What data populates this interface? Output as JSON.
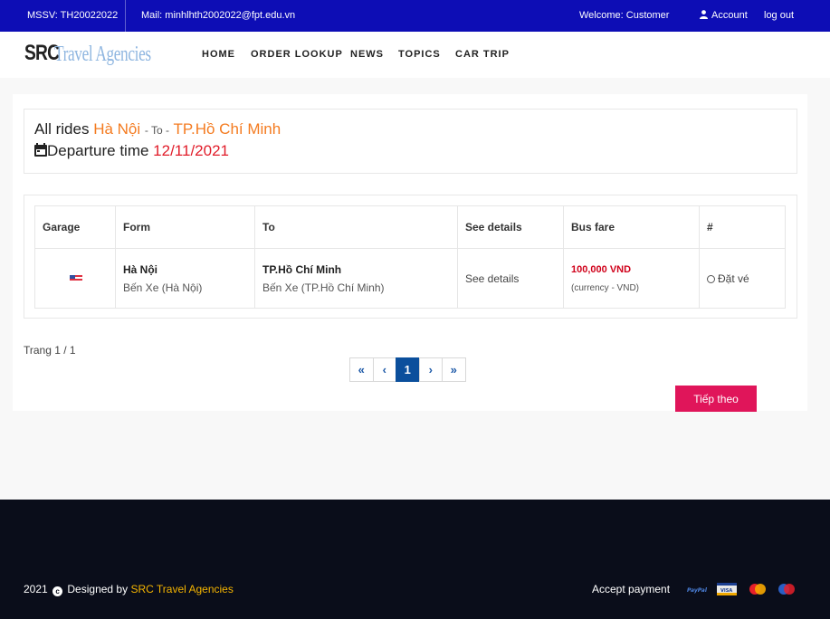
{
  "topbar": {
    "mssv": "MSSV: TH20022022",
    "mail": "Mail: minhlhth2002022@fpt.edu.vn",
    "welcome": "Welcome: Customer",
    "account": "Account",
    "logout": "log out"
  },
  "logo": {
    "src": "SRC",
    "rest": "Travel Agencies"
  },
  "nav": [
    "HOME",
    "ORDER LOOKUP",
    "NEWS",
    "TOPICS",
    "CAR TRIP"
  ],
  "route": {
    "all_rides": "All rides",
    "from": "Hà Nội",
    "to_sep": "- To -",
    "to": "TP.Hồ Chí Minh",
    "departure_label": "Departure time",
    "departure_date": "12/11/2021"
  },
  "table": {
    "headers": [
      "Garage",
      "Form",
      "To",
      "See details",
      "Bus fare",
      "#"
    ],
    "row": {
      "from_city": "Hà Nội",
      "from_station": "Bến Xe (Hà Nội)",
      "to_city": "TP.Hồ Chí Minh",
      "to_station": "Bến Xe (TP.Hồ Chí Minh)",
      "details": "See details",
      "fare": "100,000 VND",
      "currency": "(currency - VND)",
      "book": "Đặt vé"
    }
  },
  "pagination": {
    "info": "Trang 1 / 1",
    "first": "«",
    "prev": "‹",
    "current": "1",
    "next": "›",
    "last": "»"
  },
  "next_button": "Tiếp theo",
  "footer": {
    "year": "2021",
    "designed_by": "Designed by",
    "brand": "SRC Travel Agencies",
    "accept_payment": "Accept payment"
  },
  "payment_icons": [
    "paypal-icon",
    "visa-icon",
    "mastercard-icon",
    "maestro-icon"
  ],
  "colors": {
    "topbar": "#0d0db5",
    "orange": "#f47b20",
    "red": "#e11d2a",
    "button": "#e0155a",
    "footer": "#0a0d1a",
    "pager_active": "#0b4f9c"
  }
}
